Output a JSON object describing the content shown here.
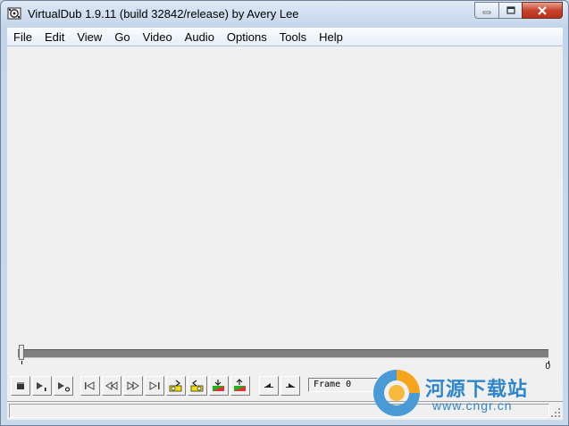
{
  "window": {
    "title": "VirtualDub 1.9.11 (build 32842/release) by Avery Lee"
  },
  "menu": [
    "File",
    "Edit",
    "View",
    "Go",
    "Video",
    "Audio",
    "Options",
    "Tools",
    "Help"
  ],
  "timeline": {
    "end_frame_label": "0",
    "position_fraction": 0
  },
  "toolbar": {
    "buttons": [
      "stop-icon",
      "play-input-icon",
      "play-output-icon",
      "go-start-icon",
      "step-back-icon",
      "step-forward-icon",
      "go-end-icon",
      "prev-keyframe-icon",
      "next-keyframe-icon",
      "prev-scene-icon",
      "next-scene-icon",
      "mark-in-icon",
      "mark-out-icon"
    ]
  },
  "frame_readout": "Frame 0",
  "watermark": {
    "text_cn": "河源下载站",
    "url": "www.cngr.cn"
  },
  "colors": {
    "titlebar": "#c3d5ea",
    "close_button": "#c7432d",
    "client": "#f0f0f0",
    "track": "#808080",
    "watermark": "#2f86c8"
  }
}
